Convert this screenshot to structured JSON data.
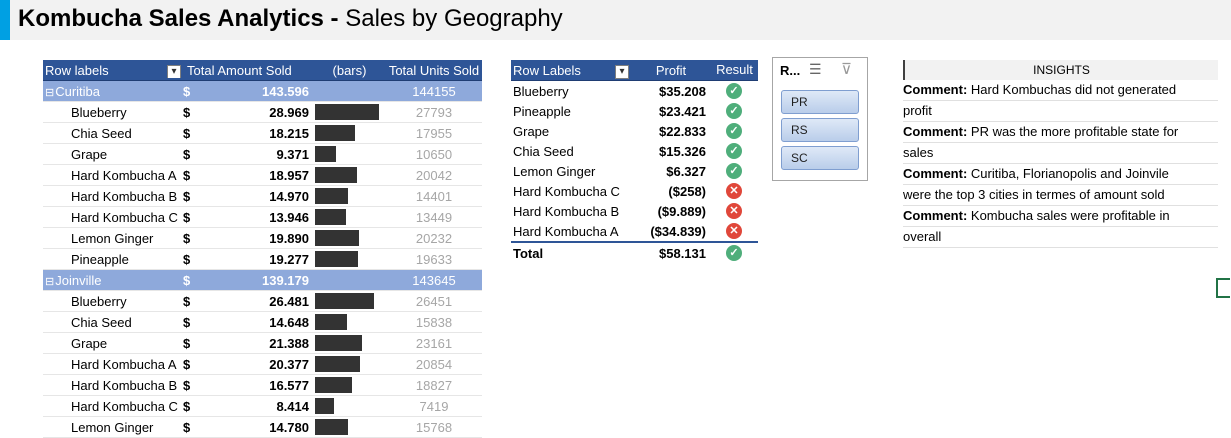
{
  "title": {
    "main": "Kombucha Sales Analytics - ",
    "sub": "Sales by Geography"
  },
  "pivot1": {
    "headers": {
      "row_labels": "Row labels",
      "amount": "Total Amount Sold",
      "bars": "(bars)",
      "units": "Total Units Sold"
    },
    "currency": "$",
    "groups": [
      {
        "name": "Curitiba",
        "amount": "143.596",
        "units": "144155",
        "items": [
          {
            "name": "Blueberry",
            "amount": "28.969",
            "value": 28.969,
            "units": "27793"
          },
          {
            "name": "Chia Seed",
            "amount": "18.215",
            "value": 18.215,
            "units": "17955"
          },
          {
            "name": "Grape",
            "amount": "9.371",
            "value": 9.371,
            "units": "10650"
          },
          {
            "name": "Hard Kombucha A",
            "amount": "18.957",
            "value": 18.957,
            "units": "20042"
          },
          {
            "name": "Hard Kombucha B",
            "amount": "14.970",
            "value": 14.97,
            "units": "14401"
          },
          {
            "name": "Hard Kombucha C",
            "amount": "13.946",
            "value": 13.946,
            "units": "13449"
          },
          {
            "name": "Lemon Ginger",
            "amount": "19.890",
            "value": 19.89,
            "units": "20232"
          },
          {
            "name": "Pineapple",
            "amount": "19.277",
            "value": 19.277,
            "units": "19633"
          }
        ]
      },
      {
        "name": "Joinville",
        "amount": "139.179",
        "units": "143645",
        "items": [
          {
            "name": "Blueberry",
            "amount": "26.481",
            "value": 26.481,
            "units": "26451"
          },
          {
            "name": "Chia Seed",
            "amount": "14.648",
            "value": 14.648,
            "units": "15838"
          },
          {
            "name": "Grape",
            "amount": "21.388",
            "value": 21.388,
            "units": "23161"
          },
          {
            "name": "Hard Kombucha A",
            "amount": "20.377",
            "value": 20.377,
            "units": "20854"
          },
          {
            "name": "Hard Kombucha B",
            "amount": "16.577",
            "value": 16.577,
            "units": "18827"
          },
          {
            "name": "Hard Kombucha C",
            "amount": "8.414",
            "value": 8.414,
            "units": "7419"
          },
          {
            "name": "Lemon Ginger",
            "amount": "14.780",
            "value": 14.78,
            "units": "15768"
          }
        ]
      }
    ]
  },
  "pivot2": {
    "headers": {
      "row_labels": "Row Labels",
      "profit": "Profit",
      "result": "Result"
    },
    "rows": [
      {
        "label": "Blueberry",
        "profit": "$35.208",
        "result": "ok"
      },
      {
        "label": "Pineapple",
        "profit": "$23.421",
        "result": "ok"
      },
      {
        "label": "Grape",
        "profit": "$22.833",
        "result": "ok"
      },
      {
        "label": "Chia Seed",
        "profit": "$15.326",
        "result": "ok"
      },
      {
        "label": "Lemon Ginger",
        "profit": "$6.327",
        "result": "ok"
      },
      {
        "label": "Hard Kombucha C",
        "profit": "($258)",
        "result": "bad"
      },
      {
        "label": "Hard Kombucha B",
        "profit": "($9.889)",
        "result": "bad"
      },
      {
        "label": "Hard Kombucha A",
        "profit": "($34.839)",
        "result": "bad"
      }
    ],
    "total": {
      "label": "Total",
      "profit": "$58.131",
      "result": "ok"
    }
  },
  "slicer": {
    "header": "R...",
    "items": [
      "PR",
      "RS",
      "SC"
    ]
  },
  "insights": {
    "header": "INSIGHTS",
    "lines": [
      {
        "bold": "Comment:",
        "text": " Hard Kombuchas did not generated"
      },
      {
        "bold": "",
        "text": "profit"
      },
      {
        "bold": "Comment:",
        "text": " PR was the more profitable state for"
      },
      {
        "bold": "",
        "text": "sales"
      },
      {
        "bold": "Comment:",
        "text": " Curitiba, Florianopolis and Joinvile"
      },
      {
        "bold": "",
        "text": "were the top 3 cities in termes of amount sold"
      },
      {
        "bold": "Comment:",
        "text": " Kombucha sales were profitable in"
      },
      {
        "bold": "",
        "text": "overall"
      }
    ]
  },
  "colors": {
    "header_blue": "#2e5597",
    "group_blue": "#8ea9db",
    "bar": "#333333",
    "ok": "#4fae7b",
    "bad": "#e0473a"
  },
  "icons": {
    "ok": "check-circle-icon",
    "bad": "x-circle-icon",
    "slicer_multiselect": "multiselect-icon",
    "slicer_clear": "clear-filter-icon"
  }
}
